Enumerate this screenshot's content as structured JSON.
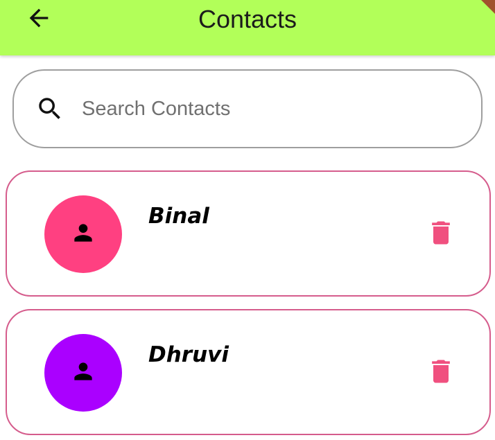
{
  "appbar": {
    "title": "Contacts",
    "background": "#b2ff59",
    "back_icon": "arrow-back-icon"
  },
  "search": {
    "placeholder": "Search Contacts",
    "value": "",
    "icon": "search-icon"
  },
  "contacts": [
    {
      "name": "Binal",
      "avatar_color": "#ff4081",
      "avatar_icon": "person-icon",
      "action_icon": "delete-icon"
    },
    {
      "name": "Dhruvi",
      "avatar_color": "#aa00ff",
      "avatar_icon": "person-icon",
      "action_icon": "delete-icon"
    }
  ],
  "colors": {
    "card_border": "#d55c8c",
    "delete_icon": "#f0507f",
    "search_border": "#9e9e9e"
  }
}
